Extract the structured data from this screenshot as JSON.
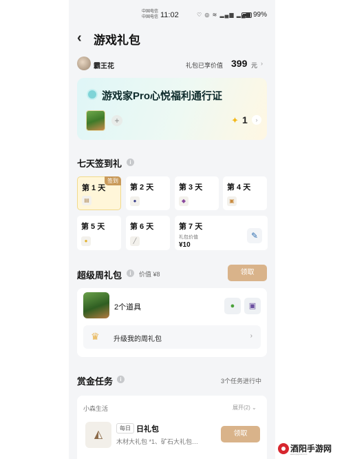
{
  "status_bar": {
    "carrier_line1": "中国电信",
    "carrier_line2": "中国电信",
    "time": "11:02",
    "icons": "♡ ◎ ≋ ▂▄▆ ▂▄▆",
    "battery": "99%"
  },
  "header": {
    "back_icon": "‹",
    "title": "游戏礼包"
  },
  "user": {
    "name": "霸王花",
    "total_label": "礼包已享价值",
    "total_value": "399",
    "total_unit": "元",
    "chevron": "›"
  },
  "pass_card": {
    "title": "游戏家Pro心悦福利通行证",
    "add_icon": "+",
    "star_icon": "✦",
    "count": "1",
    "chevron": "›"
  },
  "signin": {
    "title": "七天签到礼",
    "info_icon": "i",
    "signed_badge": "签到",
    "days": [
      {
        "label": "第 1 天",
        "icon": "▤"
      },
      {
        "label": "第 2 天",
        "icon": "●"
      },
      {
        "label": "第 3 天",
        "icon": "◆"
      },
      {
        "label": "第 4 天",
        "icon": "▣"
      },
      {
        "label": "第 5 天",
        "icon": "●"
      },
      {
        "label": "第 6 天",
        "icon": "╱"
      },
      {
        "label": "第 7 天",
        "icon": "✎"
      }
    ],
    "day7_value_label": "礼包价值",
    "day7_value": "¥10"
  },
  "weekly": {
    "title": "超级周礼包",
    "info_icon": "i",
    "price": "价值 ¥8",
    "claim_label": "领取",
    "items_count": "2个道具",
    "item_icons": [
      "●",
      "▣"
    ],
    "upgrade_label": "升级我的周礼包",
    "upgrade_chevron": "›"
  },
  "bounty": {
    "title": "赏金任务",
    "info_icon": "i",
    "progress": "3个任务进行中",
    "group_name": "小森生活",
    "expand_label": "展开(2) ⌄",
    "task_icon": "◭",
    "task_tag": "每日",
    "task_name": "日礼包",
    "task_desc": "木材大礼包 *1、矿石大礼包…",
    "claim_label": "领取"
  },
  "watermark": {
    "text": "酒阳手游网",
    "sub": "www.zjsyouxi.com"
  },
  "colors": {
    "accent": "#d9b38a",
    "active_day_bg": "#fff6d9",
    "signed_badge": "#c99a5a",
    "page_bg": "#f4f5f7"
  }
}
